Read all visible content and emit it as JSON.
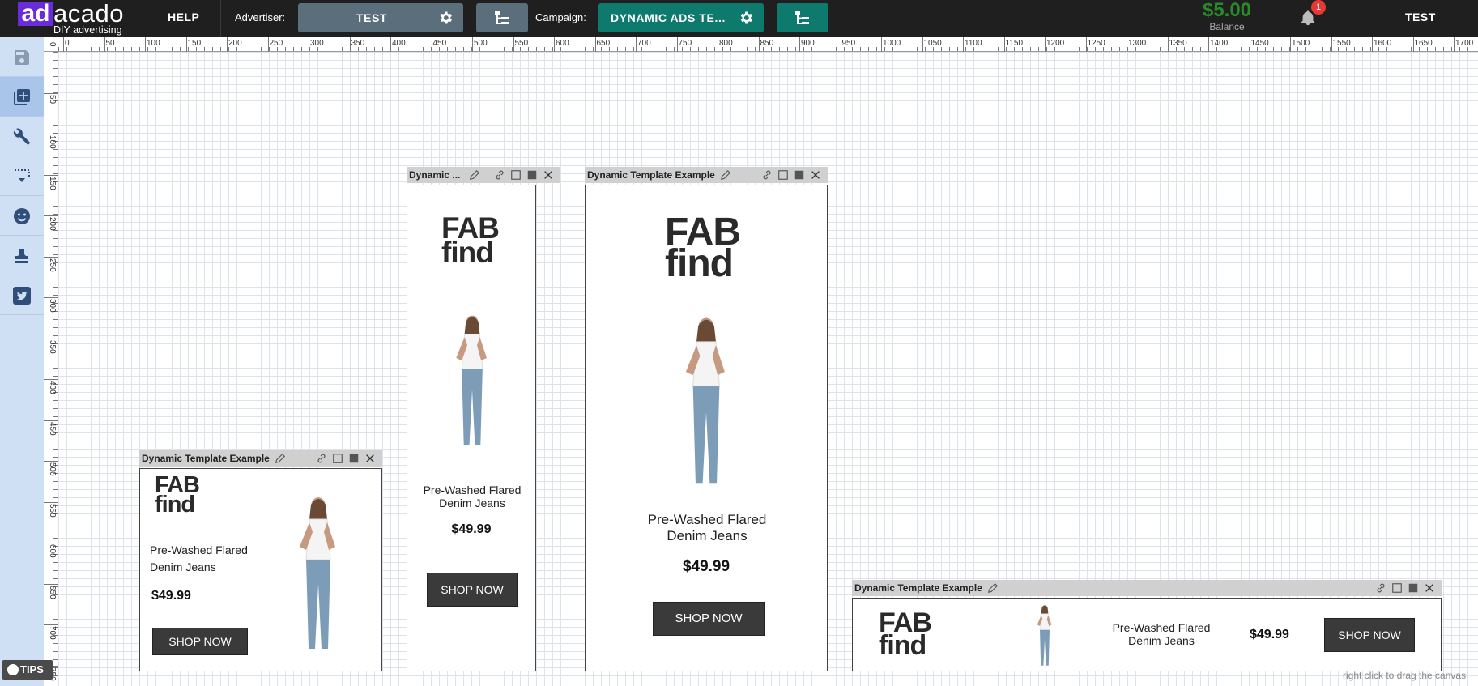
{
  "topbar": {
    "logo_ad": "ad",
    "logo_rest": "acado",
    "logo_sub": "DIY advertising",
    "help": "HELP",
    "advertiser_label": "Advertiser:",
    "advertiser_value": "TEST",
    "campaign_label": "Campaign:",
    "campaign_value": "DYNAMIC ADS TE...",
    "balance_amount": "$5.00",
    "balance_label": "Balance",
    "notifications_count": "1",
    "user": "TEST"
  },
  "sidebar": {
    "tools": [
      "save-icon",
      "add-layer-icon",
      "tools-icon",
      "selection-icon",
      "emoji-icon",
      "stamp-icon",
      "twitter-icon"
    ],
    "active_index": 1,
    "tips_label": "TIPS"
  },
  "rulers": {
    "x_labels": [
      "0",
      "50",
      "100",
      "150",
      "200",
      "250",
      "300",
      "350",
      "400",
      "450",
      "500",
      "550",
      "600",
      "650",
      "700",
      "750",
      "800",
      "850",
      "900",
      "950",
      "1000",
      "1050",
      "1100",
      "1150",
      "1200",
      "1250",
      "1300",
      "1350",
      "1400",
      "1450",
      "1500",
      "1550",
      "1600",
      "1650",
      "1700"
    ],
    "y_labels": [
      "50",
      "100",
      "150",
      "200",
      "250",
      "300",
      "350",
      "400",
      "450",
      "500",
      "550",
      "600",
      "650",
      "700",
      "750"
    ],
    "corner": "0"
  },
  "units": [
    {
      "title": "Dynamic Template Example",
      "logo_line1": "FAB",
      "logo_line2": "find",
      "product": "Pre-Washed Flared Denim Jeans",
      "price": "$49.99",
      "cta": "SHOP NOW"
    },
    {
      "title": "Dynamic ...",
      "logo_line1": "FAB",
      "logo_line2": "find",
      "product": "Pre-Washed Flared Denim Jeans",
      "price": "$49.99",
      "cta": "SHOP NOW"
    },
    {
      "title": "Dynamic Template Example",
      "logo_line1": "FAB",
      "logo_line2": "find",
      "product": "Pre-Washed Flared Denim Jeans",
      "price": "$49.99",
      "cta": "SHOP NOW"
    },
    {
      "title": "Dynamic Template Example",
      "logo_line1": "FAB",
      "logo_line2": "find",
      "product": "Pre-Washed Flared Denim Jeans",
      "price": "$49.99",
      "cta": "SHOP NOW"
    }
  ],
  "canvas_hint": "right click to drag the canvas",
  "colors": {
    "topbar": "#1f1f1f",
    "advertiser_pill": "#5a6e7c",
    "campaign_pill": "#0e7a6e",
    "brand": "#6a2cd8",
    "balance": "#2a8a2a",
    "sidebar": "#cfe0f5"
  }
}
